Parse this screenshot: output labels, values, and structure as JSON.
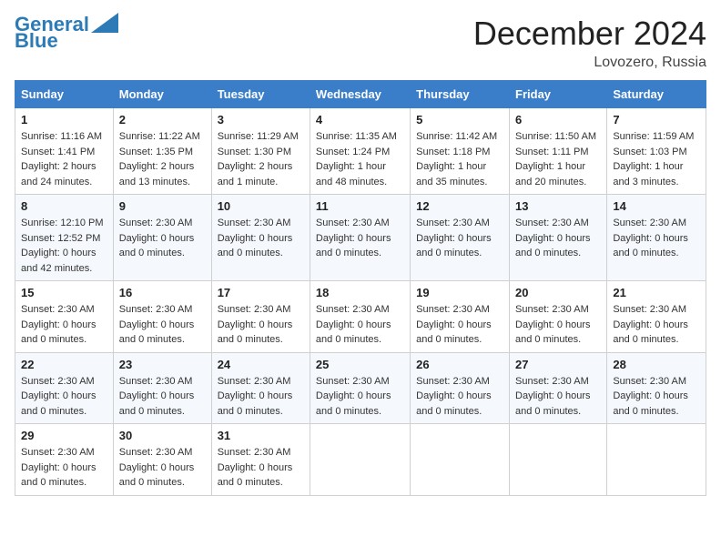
{
  "header": {
    "logo_line1": "General",
    "logo_line2": "Blue",
    "month_title": "December 2024",
    "location": "Lovozero, Russia"
  },
  "calendar": {
    "days_of_week": [
      "Sunday",
      "Monday",
      "Tuesday",
      "Wednesday",
      "Thursday",
      "Friday",
      "Saturday"
    ],
    "weeks": [
      [
        {
          "day": "1",
          "info": "Sunrise: 11:16 AM\nSunset: 1:41 PM\nDaylight: 2 hours and 24 minutes."
        },
        {
          "day": "2",
          "info": "Sunrise: 11:22 AM\nSunset: 1:35 PM\nDaylight: 2 hours and 13 minutes."
        },
        {
          "day": "3",
          "info": "Sunrise: 11:29 AM\nSunset: 1:30 PM\nDaylight: 2 hours and 1 minute."
        },
        {
          "day": "4",
          "info": "Sunrise: 11:35 AM\nSunset: 1:24 PM\nDaylight: 1 hour and 48 minutes."
        },
        {
          "day": "5",
          "info": "Sunrise: 11:42 AM\nSunset: 1:18 PM\nDaylight: 1 hour and 35 minutes."
        },
        {
          "day": "6",
          "info": "Sunrise: 11:50 AM\nSunset: 1:11 PM\nDaylight: 1 hour and 20 minutes."
        },
        {
          "day": "7",
          "info": "Sunrise: 11:59 AM\nSunset: 1:03 PM\nDaylight: 1 hour and 3 minutes."
        }
      ],
      [
        {
          "day": "8",
          "info": "Sunrise: 12:10 PM\nSunset: 12:52 PM\nDaylight: 0 hours and 42 minutes."
        },
        {
          "day": "9",
          "info": "Sunset: 2:30 AM\nDaylight: 0 hours and 0 minutes."
        },
        {
          "day": "10",
          "info": "Sunset: 2:30 AM\nDaylight: 0 hours and 0 minutes."
        },
        {
          "day": "11",
          "info": "Sunset: 2:30 AM\nDaylight: 0 hours and 0 minutes."
        },
        {
          "day": "12",
          "info": "Sunset: 2:30 AM\nDaylight: 0 hours and 0 minutes."
        },
        {
          "day": "13",
          "info": "Sunset: 2:30 AM\nDaylight: 0 hours and 0 minutes."
        },
        {
          "day": "14",
          "info": "Sunset: 2:30 AM\nDaylight: 0 hours and 0 minutes."
        }
      ],
      [
        {
          "day": "15",
          "info": "Sunset: 2:30 AM\nDaylight: 0 hours and 0 minutes."
        },
        {
          "day": "16",
          "info": "Sunset: 2:30 AM\nDaylight: 0 hours and 0 minutes."
        },
        {
          "day": "17",
          "info": "Sunset: 2:30 AM\nDaylight: 0 hours and 0 minutes."
        },
        {
          "day": "18",
          "info": "Sunset: 2:30 AM\nDaylight: 0 hours and 0 minutes."
        },
        {
          "day": "19",
          "info": "Sunset: 2:30 AM\nDaylight: 0 hours and 0 minutes."
        },
        {
          "day": "20",
          "info": "Sunset: 2:30 AM\nDaylight: 0 hours and 0 minutes."
        },
        {
          "day": "21",
          "info": "Sunset: 2:30 AM\nDaylight: 0 hours and 0 minutes."
        }
      ],
      [
        {
          "day": "22",
          "info": "Sunset: 2:30 AM\nDaylight: 0 hours and 0 minutes."
        },
        {
          "day": "23",
          "info": "Sunset: 2:30 AM\nDaylight: 0 hours and 0 minutes."
        },
        {
          "day": "24",
          "info": "Sunset: 2:30 AM\nDaylight: 0 hours and 0 minutes."
        },
        {
          "day": "25",
          "info": "Sunset: 2:30 AM\nDaylight: 0 hours and 0 minutes."
        },
        {
          "day": "26",
          "info": "Sunset: 2:30 AM\nDaylight: 0 hours and 0 minutes."
        },
        {
          "day": "27",
          "info": "Sunset: 2:30 AM\nDaylight: 0 hours and 0 minutes."
        },
        {
          "day": "28",
          "info": "Sunset: 2:30 AM\nDaylight: 0 hours and 0 minutes."
        }
      ],
      [
        {
          "day": "29",
          "info": "Sunset: 2:30 AM\nDaylight: 0 hours and 0 minutes."
        },
        {
          "day": "30",
          "info": "Sunset: 2:30 AM\nDaylight: 0 hours and 0 minutes."
        },
        {
          "day": "31",
          "info": "Sunset: 2:30 AM\nDaylight: 0 hours and 0 minutes."
        },
        {
          "day": "",
          "info": ""
        },
        {
          "day": "",
          "info": ""
        },
        {
          "day": "",
          "info": ""
        },
        {
          "day": "",
          "info": ""
        }
      ]
    ]
  }
}
